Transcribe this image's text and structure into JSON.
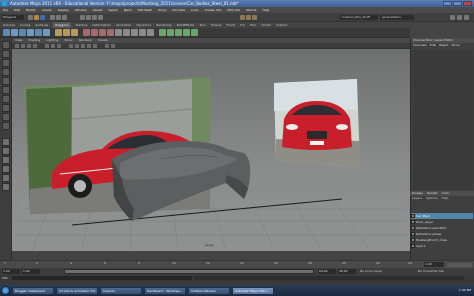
{
  "window": {
    "title": "Autodesk Maya 2011 x64 - Educational Version: F:\\maya\\projects\\Mustang_2011\\scenes\\Car_Bodies_Steel_01.mb*"
  },
  "menu": [
    "File",
    "Edit",
    "Modify",
    "Create",
    "Display",
    "Window",
    "Assets",
    "Select",
    "Mesh",
    "Edit Mesh",
    "Proxy",
    "Normals",
    "Color",
    "Create UVs",
    "Edit UVs",
    "Muscle",
    "Help"
  ],
  "statusline": {
    "mode": "Polygons",
    "name_field": "Custom_Poly_Stuff",
    "name_field2": "generalTools"
  },
  "shelf_tabs": [
    "General",
    "Curves",
    "Surfaces",
    "Polygons",
    "Subdivs",
    "Deformation",
    "Animation",
    "Dynamics",
    "Rendering",
    "PaintEffects",
    "Toon",
    "Muscle",
    "Fluids",
    "Fur",
    "Hair",
    "nCloth",
    "Custom"
  ],
  "shelf_active": "Polygons",
  "panel_menu": [
    "View",
    "Shading",
    "Lighting",
    "Show",
    "Renderer",
    "Panels"
  ],
  "viewport": {
    "camera": "persp"
  },
  "channel_box": {
    "title": "Channel Box / Layer Editor",
    "tabs": [
      "Channels",
      "Edit",
      "Object",
      "Show"
    ]
  },
  "layer_editor": {
    "tabs": [
      "Display",
      "Render",
      "Anim"
    ],
    "menu": [
      "Layers",
      "Options",
      "Help"
    ],
    "layers": [
      {
        "name": "Car_Pbod",
        "selected": true
      },
      {
        "name": "Over_Layer",
        "selected": false
      },
      {
        "name": "DetailsCurveAndPos",
        "selected": false
      },
      {
        "name": "DetailsCurveVew",
        "selected": false
      },
      {
        "name": "MustangFront1_lmas",
        "selected": false
      },
      {
        "name": "layer1",
        "selected": false
      }
    ]
  },
  "timeslider": {
    "ticks": [
      "1",
      "2",
      "4",
      "6",
      "8",
      "10",
      "12",
      "14",
      "16",
      "18",
      "20",
      "22",
      "24"
    ],
    "current": "1.00"
  },
  "range": {
    "start": "1.00",
    "inner_start": "1.00",
    "inner_end": "24.00",
    "end": "48.00",
    "anim_layer": "No Anim Layer",
    "char_set": "No Character Set"
  },
  "cmdline": {
    "label": "MEL"
  },
  "help": "",
  "taskbar": {
    "items": [
      "Blogger: Dashboard",
      "C4 Arts & Animation Tut...",
      "scanner",
      "Dashboard - Windows...",
      "Untitled Window",
      "Autodesk Maya 2011..."
    ],
    "active_index": 5,
    "clock": "1:42 PM"
  },
  "colors": {
    "viewport_top": "#6e7070",
    "viewport_bottom": "#909191",
    "car_red": "#c81f2a",
    "layer_selected": "#5285a6",
    "titlebar": "#4a6fa5"
  }
}
